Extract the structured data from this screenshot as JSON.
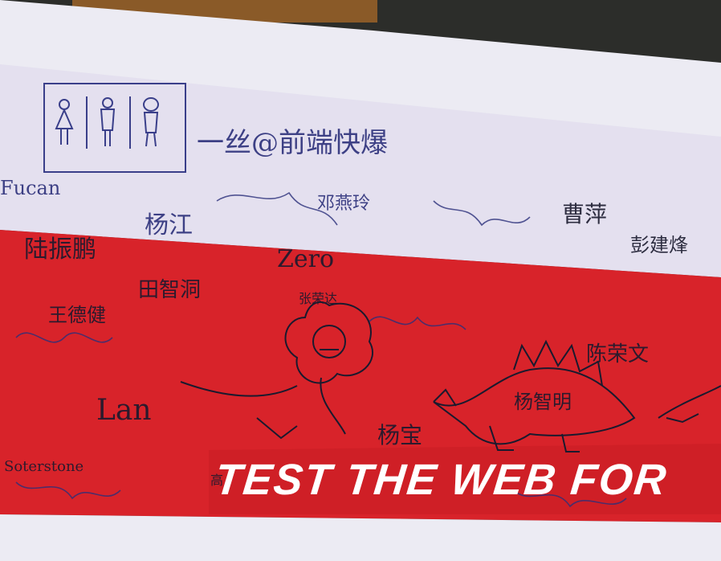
{
  "banner": {
    "slogan": "TEST THE WEB FOR",
    "colors": {
      "white_band": "#ecebf3",
      "red_band": "#d8232a",
      "ink": "#2b2f7a",
      "dark_bg": "#2c2d2a"
    }
  },
  "signatures": {
    "top_phrase": "一丝@前端快爆",
    "sig_left": "杨江",
    "sig_mid": "邓燕玲",
    "sig_far_left": "Fucan",
    "sig_zero": "Zero",
    "sig_line1": "陆振鹏",
    "sig_line2": "田智洞",
    "sig_line3": "王德健",
    "sig_lion": "张荣达",
    "sig_right1": "曹萍",
    "sig_right2": "彭建烽",
    "sig_right3": "陈荣文",
    "sig_right4": "杨智明",
    "sig_bottom1": "Soterstone",
    "sig_bottom2": "Lan",
    "sig_bottom3": "杨宝",
    "sig_bottom4": "高"
  },
  "icons": [
    "restroom-sign-icon",
    "lion-doodle-icon",
    "stegosaurus-doodle-icon"
  ]
}
